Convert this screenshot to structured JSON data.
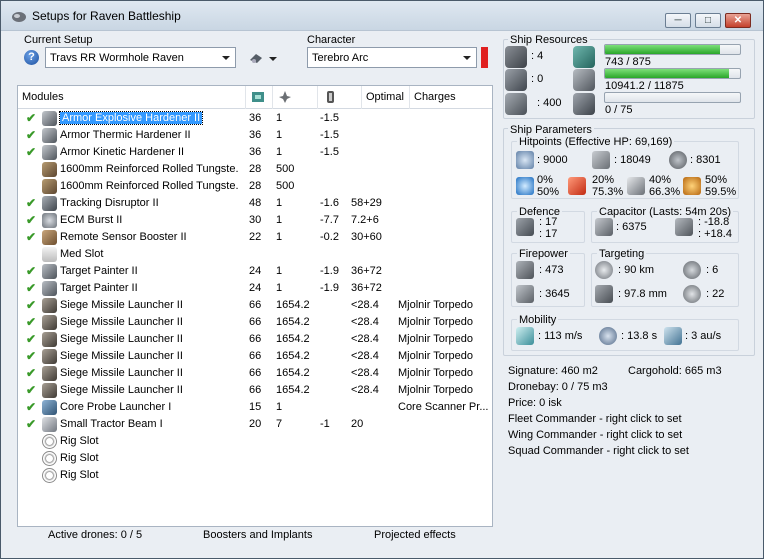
{
  "window": {
    "title": "Setups for Raven Battleship",
    "minimize_icon": "minimize-icon",
    "maximize_icon": "maximize-icon",
    "close_icon": "close-icon"
  },
  "setup": {
    "label": "Current Setup",
    "value": "Travs  RR Wormhole Raven",
    "help": "?"
  },
  "character": {
    "label": "Character",
    "value": "Terebro Arc",
    "indicator_color": "#e02020"
  },
  "modules": {
    "headers": [
      "Modules",
      "",
      "",
      "",
      "Optimal",
      "Charges"
    ],
    "header_icons": [
      "cpu-icon",
      "powergrid-icon",
      "capacitor-icon"
    ],
    "rows": [
      {
        "checked": true,
        "icon": "armor-hardener-icon",
        "name": "Armor Explosive Hardener II",
        "cpu": "36",
        "pg": "1",
        "cap": "-1.5",
        "optimal": "",
        "charges": "",
        "selected": true
      },
      {
        "checked": true,
        "icon": "armor-hardener-icon",
        "name": "Armor Thermic Hardener II",
        "cpu": "36",
        "pg": "1",
        "cap": "-1.5",
        "optimal": "",
        "charges": ""
      },
      {
        "checked": true,
        "icon": "armor-hardener-icon",
        "name": "Armor Kinetic Hardener II",
        "cpu": "36",
        "pg": "1",
        "cap": "-1.5",
        "optimal": "",
        "charges": ""
      },
      {
        "checked": false,
        "icon": "armor-plate-icon",
        "name": "1600mm Reinforced Rolled Tungste...",
        "cpu": "28",
        "pg": "500",
        "cap": "",
        "optimal": "",
        "charges": ""
      },
      {
        "checked": false,
        "icon": "armor-plate-icon",
        "name": "1600mm Reinforced Rolled Tungste...",
        "cpu": "28",
        "pg": "500",
        "cap": "",
        "optimal": "",
        "charges": ""
      },
      {
        "checked": true,
        "icon": "tracking-disruptor-icon",
        "name": "Tracking Disruptor II",
        "cpu": "48",
        "pg": "1",
        "cap": "-1.6",
        "optimal": "58+29",
        "charges": ""
      },
      {
        "checked": true,
        "icon": "ecm-burst-icon",
        "name": "ECM Burst II",
        "cpu": "30",
        "pg": "1",
        "cap": "-7.7",
        "optimal": "7.2+6",
        "charges": ""
      },
      {
        "checked": true,
        "icon": "sensor-booster-icon",
        "name": "Remote Sensor Booster II",
        "cpu": "22",
        "pg": "1",
        "cap": "-0.2",
        "optimal": "30+60",
        "charges": ""
      },
      {
        "checked": false,
        "icon": "med-slot-icon",
        "name": "Med Slot",
        "cpu": "",
        "pg": "",
        "cap": "",
        "optimal": "",
        "charges": ""
      },
      {
        "checked": true,
        "icon": "target-painter-icon",
        "name": "Target Painter II",
        "cpu": "24",
        "pg": "1",
        "cap": "-1.9",
        "optimal": "36+72",
        "charges": ""
      },
      {
        "checked": true,
        "icon": "target-painter-icon",
        "name": "Target Painter II",
        "cpu": "24",
        "pg": "1",
        "cap": "-1.9",
        "optimal": "36+72",
        "charges": ""
      },
      {
        "checked": true,
        "icon": "missile-launcher-icon",
        "name": "Siege Missile Launcher II",
        "cpu": "66",
        "pg": "1654.2",
        "cap": "",
        "optimal": "<28.4",
        "charges": "Mjolnir Torpedo"
      },
      {
        "checked": true,
        "icon": "missile-launcher-icon",
        "name": "Siege Missile Launcher II",
        "cpu": "66",
        "pg": "1654.2",
        "cap": "",
        "optimal": "<28.4",
        "charges": "Mjolnir Torpedo"
      },
      {
        "checked": true,
        "icon": "missile-launcher-icon",
        "name": "Siege Missile Launcher II",
        "cpu": "66",
        "pg": "1654.2",
        "cap": "",
        "optimal": "<28.4",
        "charges": "Mjolnir Torpedo"
      },
      {
        "checked": true,
        "icon": "missile-launcher-icon",
        "name": "Siege Missile Launcher II",
        "cpu": "66",
        "pg": "1654.2",
        "cap": "",
        "optimal": "<28.4",
        "charges": "Mjolnir Torpedo"
      },
      {
        "checked": true,
        "icon": "missile-launcher-icon",
        "name": "Siege Missile Launcher II",
        "cpu": "66",
        "pg": "1654.2",
        "cap": "",
        "optimal": "<28.4",
        "charges": "Mjolnir Torpedo"
      },
      {
        "checked": true,
        "icon": "missile-launcher-icon",
        "name": "Siege Missile Launcher II",
        "cpu": "66",
        "pg": "1654.2",
        "cap": "",
        "optimal": "<28.4",
        "charges": "Mjolnir Torpedo"
      },
      {
        "checked": true,
        "icon": "probe-launcher-icon",
        "name": "Core Probe Launcher I",
        "cpu": "15",
        "pg": "1",
        "cap": "",
        "optimal": "",
        "charges": "Core Scanner Pr..."
      },
      {
        "checked": true,
        "icon": "tractor-beam-icon",
        "name": "Small Tractor Beam I",
        "cpu": "20",
        "pg": "7",
        "cap": "-1",
        "optimal": "20",
        "charges": ""
      },
      {
        "checked": false,
        "icon": "rig-slot-icon",
        "name": "Rig Slot",
        "cpu": "",
        "pg": "",
        "cap": "",
        "optimal": "",
        "charges": ""
      },
      {
        "checked": false,
        "icon": "rig-slot-icon",
        "name": "Rig Slot",
        "cpu": "",
        "pg": "",
        "cap": "",
        "optimal": "",
        "charges": ""
      },
      {
        "checked": false,
        "icon": "rig-slot-icon",
        "name": "Rig Slot",
        "cpu": "",
        "pg": "",
        "cap": "",
        "optimal": "",
        "charges": ""
      }
    ]
  },
  "footer": {
    "drones": "Active drones: 0 / 5",
    "boosters": "Boosters and Implants",
    "projected": "Projected effects"
  },
  "resources": {
    "title": "Ship Resources",
    "turrets": ": 4",
    "launchers": ": 0",
    "calibration": ": 400",
    "cpu": "743 / 875",
    "powergrid": "10941.2 / 11875",
    "drone_bandwidth": "0 / 75",
    "cpu_fraction": 0.849,
    "pg_fraction": 0.921,
    "bandwidth_fraction": 0
  },
  "params": {
    "title": "Ship Parameters",
    "hitpoints_title": "Hitpoints (Effective HP: 69,169)",
    "shield_hp": ": 9000",
    "armor_hp": ": 18049",
    "structure_hp": ": 8301",
    "resist_em_shield": "0%",
    "resist_em_armor": "50%",
    "resist_th_shield": "20%",
    "resist_th_armor": "75.3%",
    "resist_kin_shield": "40%",
    "resist_kin_armor": "66.3%",
    "resist_exp_shield": "50%",
    "resist_exp_armor": "59.5%",
    "defence_title": "Defence",
    "defence_a": ": 17",
    "defence_b": ": 17",
    "capacitor_title": "Capacitor (Lasts: 54m 20s)",
    "capacitor_amount": ": 6375",
    "capacitor_use": ": -18.8",
    "capacitor_recharge": ": +18.4",
    "firepower_title": "Firepower",
    "firepower_dps": ": 473",
    "firepower_volley": ": 3645",
    "targeting_title": "Targeting",
    "target_range": ": 90 km",
    "max_targets": ": 6",
    "sig_resolution": ": 97.8 mm",
    "sensor_strength": ": 22",
    "mobility_title": "Mobility",
    "velocity": ": 113 m/s",
    "align_time": ": 13.8 s",
    "warp_speed": ": 3 au/s",
    "signature": "Signature: 460 m2",
    "cargohold": "Cargohold: 665 m3",
    "dronebay": "Dronebay: 0 / 75 m3",
    "price": "Price: 0 isk",
    "fleet_commander": "Fleet Commander - right click to set",
    "wing_commander": "Wing Commander - right click to set",
    "squad_commander": "Squad Commander - right click to set"
  }
}
